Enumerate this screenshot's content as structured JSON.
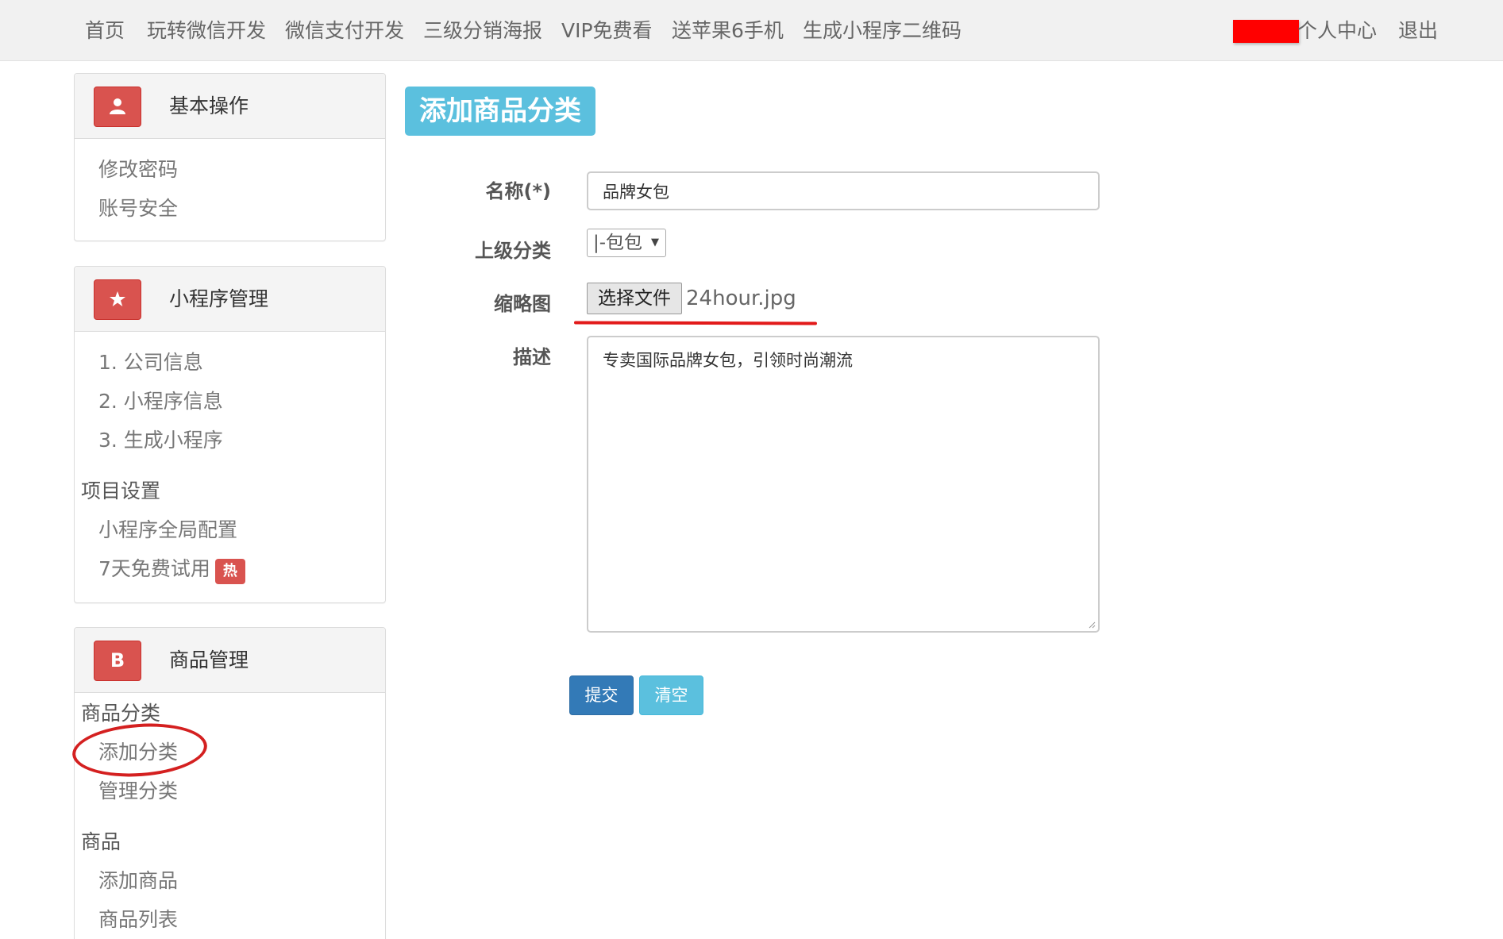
{
  "topnav": {
    "items": [
      "首页",
      "玩转微信开发",
      "微信支付开发",
      "三级分销海报",
      "VIP免费看",
      "送苹果6手机",
      "生成小程序二维码"
    ],
    "user_center": "个人中心",
    "logout": "退出"
  },
  "sidebar": {
    "basic": {
      "title": "基本操作",
      "icon": "user-icon",
      "links": [
        "修改密码",
        "账号安全"
      ]
    },
    "miniprogram": {
      "title": "小程序管理",
      "icon": "star-icon",
      "links": [
        "1. 公司信息",
        "2. 小程序信息",
        "3. 生成小程序"
      ],
      "group": "项目设置",
      "group_links": [
        "小程序全局配置",
        "7天免费试用"
      ],
      "hot_badge": "热"
    },
    "goods": {
      "title": "商品管理",
      "icon": "bitcoin-icon",
      "icon_glyph": "B",
      "group1": "商品分类",
      "group1_links": [
        "添加分类",
        "管理分类"
      ],
      "group2": "商品",
      "group2_links": [
        "添加商品",
        "商品列表"
      ]
    }
  },
  "main": {
    "title": "添加商品分类",
    "form": {
      "name_label": "名称(*)",
      "name_value": "品牌女包",
      "parent_label": "上级分类",
      "parent_value": "|-包包",
      "thumb_label": "缩略图",
      "file_button": "选择文件",
      "file_name": "24hour.jpg",
      "desc_label": "描述",
      "desc_value": "专卖国际品牌女包，引领时尚潮流",
      "submit": "提交",
      "clear": "清空"
    }
  },
  "colors": {
    "danger": "#d9534f",
    "info": "#5bc0de",
    "primary": "#337ab7",
    "annotation_red": "#e21a1a"
  }
}
